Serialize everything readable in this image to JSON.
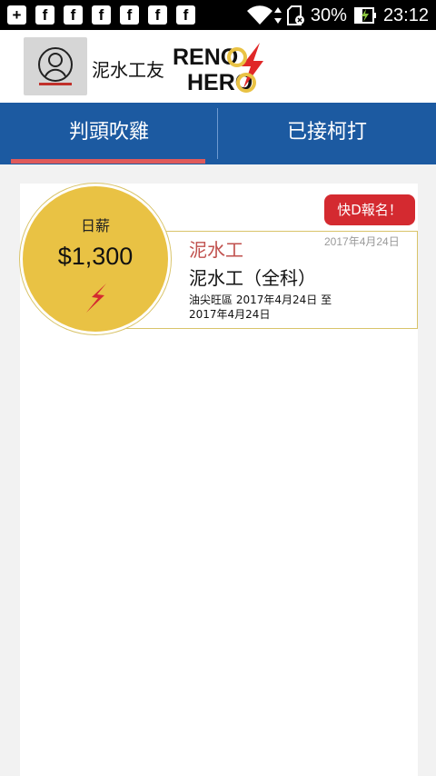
{
  "status_bar": {
    "notification_icons": [
      "add-icon",
      "facebook-icon",
      "facebook-icon",
      "facebook-icon",
      "facebook-icon",
      "facebook-icon",
      "facebook-icon"
    ],
    "battery_percent": "30%",
    "time": "23:12"
  },
  "header": {
    "brand_name": "泥水工友",
    "logo_line1": "RENO",
    "logo_line2": "HERO"
  },
  "tabs": [
    {
      "label": "判頭吹雞",
      "active": true
    },
    {
      "label": "已接柯打",
      "active": false
    }
  ],
  "colors": {
    "tab_bar": "#1c5aa1",
    "tab_indicator": "#e05a5a",
    "wage_circle": "#e9c244",
    "signup_button": "#d42a30",
    "category_text": "#c0504d"
  },
  "job": {
    "wage_label": "日薪",
    "wage_amount": "$1,300",
    "signup_label": "快D報名！",
    "posted_date": "2017年4月24日",
    "category": "泥水工",
    "title": "泥水工（全科）",
    "location_dates": "油尖旺區 2017年4月24日 至 2017年4月24日"
  }
}
